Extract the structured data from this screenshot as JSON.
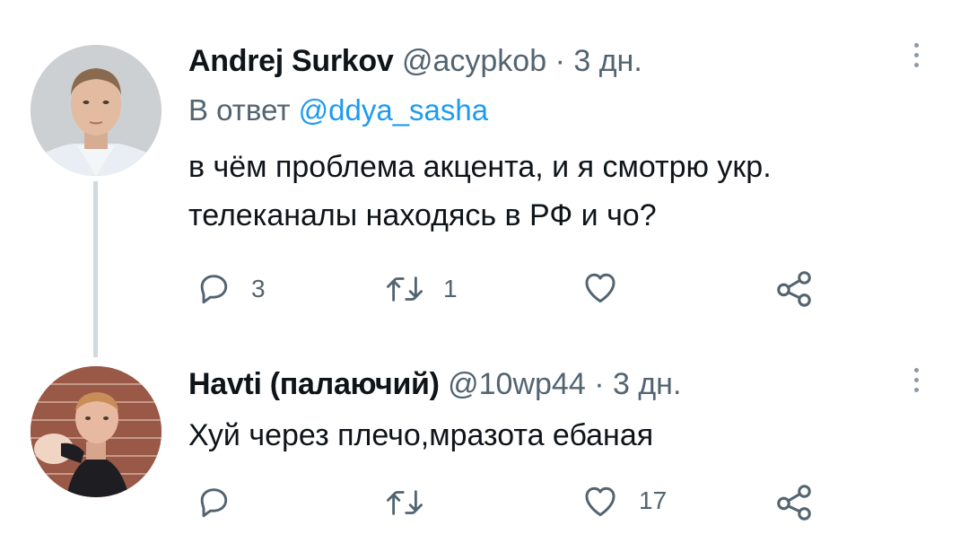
{
  "tweets": [
    {
      "author_name": "Andrej Surkov",
      "handle": "@acypkob",
      "separator": "·",
      "time": "3 дн.",
      "reply_prefix": "В ответ",
      "reply_to": "@ddya_sasha",
      "text_line1": "в чём проблема акцента, и я смотрю укр.",
      "text_line2": "телеканалы находясь в РФ и чо?",
      "replies": "3",
      "retweets": "1",
      "likes": ""
    },
    {
      "author_name": "Havti (палаючий)",
      "handle": "@10wp44",
      "separator": "·",
      "time": "3 дн.",
      "text_line1": "Хуй через плечо,мразота ебаная",
      "replies": "",
      "retweets": "",
      "likes": "17"
    }
  ],
  "icons": {
    "reply": "reply-icon",
    "retweet": "retweet-icon",
    "like": "heart-icon",
    "share": "share-icon",
    "more": "more-icon"
  },
  "colors": {
    "muted": "#536471",
    "link": "#1d9bf0",
    "thread_line": "#cfd9de"
  }
}
